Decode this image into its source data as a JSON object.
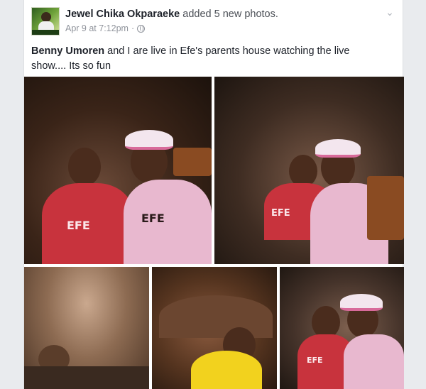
{
  "post": {
    "author": "Jewel Chika Okparaeke",
    "action": "added 5 new photos.",
    "timestamp": "Apr 9 at 7:12pm",
    "separator": "·",
    "privacy_icon": "globe-icon",
    "menu_icon": "chevron-down-icon"
  },
  "body": {
    "mention": "Benny Umoren",
    "text": "and I are live in Efe's parents house watching the live show.... Its so fun"
  },
  "photos": {
    "count": 5,
    "shirt_print": "EFE",
    "shirt_print_2": "EFE"
  },
  "colors": {
    "author": "#1d2129",
    "meta": "#90949c",
    "background": "#e9ebee"
  }
}
